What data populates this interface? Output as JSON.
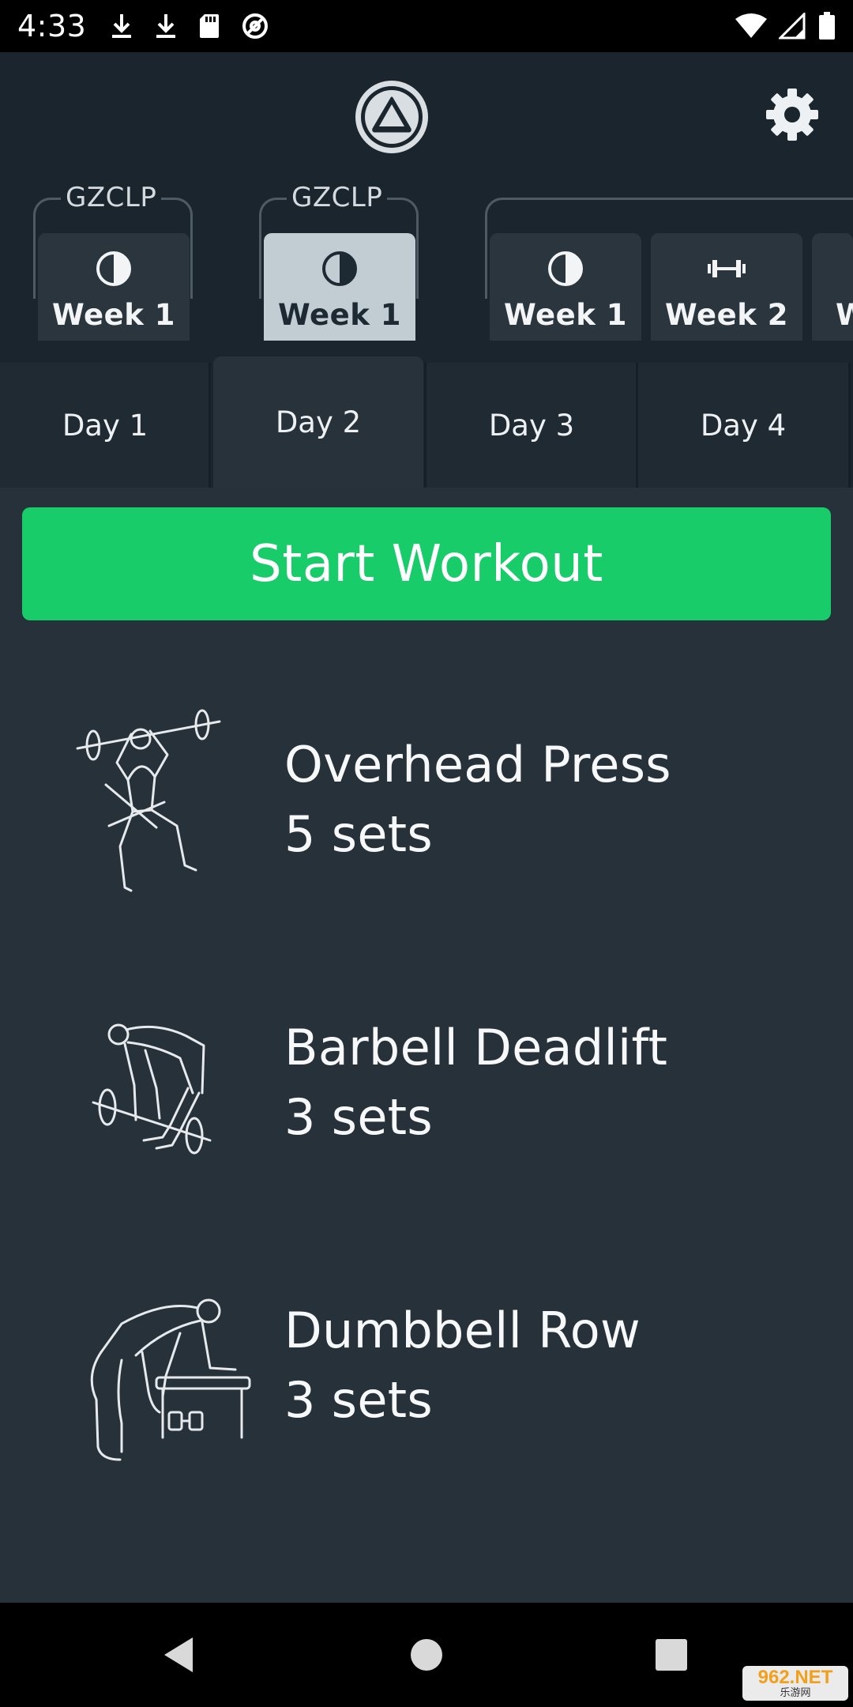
{
  "status_bar": {
    "time": "4:33",
    "left_icons": [
      "download-icon",
      "download-icon",
      "sd-card-icon",
      "at-sign-icon"
    ],
    "right_icons": [
      "wifi-icon",
      "cellular-signal-icon",
      "battery-icon"
    ]
  },
  "header": {
    "logo_icon": "triangle-logo-icon",
    "settings_icon": "gear-icon"
  },
  "programs": [
    {
      "label": "GZCLP",
      "weeks": [
        {
          "label": "Week 1",
          "icon": "half-circle-icon",
          "active": false
        }
      ]
    },
    {
      "label": "GZCLP",
      "weeks": [
        {
          "label": "Week 1",
          "icon": "half-circle-icon",
          "active": true
        }
      ]
    },
    {
      "label": "",
      "weeks": [
        {
          "label": "Week 1",
          "icon": "half-circle-icon",
          "active": false
        },
        {
          "label": "Week 2",
          "icon": "dumbbell-icon",
          "active": false
        },
        {
          "label": "W",
          "icon": "",
          "active": false
        }
      ]
    }
  ],
  "days": [
    {
      "label": "Day 1",
      "active": false
    },
    {
      "label": "Day 2",
      "active": true
    },
    {
      "label": "Day 3",
      "active": false
    },
    {
      "label": "Day 4",
      "active": false
    }
  ],
  "start_button": {
    "label": "Start Workout"
  },
  "exercises": [
    {
      "name": "Overhead Press",
      "sets": "5 sets",
      "illustration": "overhead-press-illustration"
    },
    {
      "name": "Barbell Deadlift",
      "sets": "3 sets",
      "illustration": "deadlift-illustration"
    },
    {
      "name": "Dumbbell Row",
      "sets": "3 sets",
      "illustration": "dumbbell-row-illustration"
    }
  ],
  "nav": {
    "back": "back-icon",
    "home": "home-icon",
    "recents": "recents-icon"
  },
  "watermark": {
    "top": "962.NET",
    "bottom": "乐游网"
  },
  "colors": {
    "accent": "#17cc69",
    "header_bg": "#1b252e",
    "content_bg": "#27313a",
    "active_week": "#c1ccd3"
  }
}
